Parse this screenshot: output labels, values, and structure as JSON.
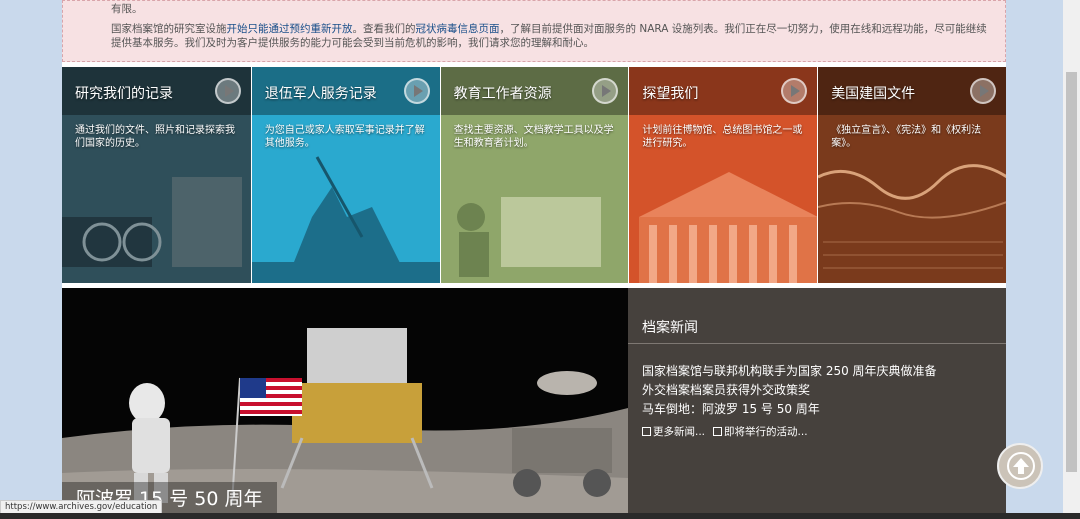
{
  "alert": {
    "line0": "有限。",
    "para_pre": "国家档案馆的研究室设施",
    "link1": "开始只能通过预约重新开放",
    "para_mid": "。查看我们的",
    "link2": "冠状病毒信息页面",
    "para_post": "，了解目前提供面对面服务的 NARA 设施列表。我们正在尽一切努力，使用在线和远程功能，尽可能继续提供基本服务。我们及时为客户提供服务的能力可能会受到当前危机的影响，我们请求您的理解和耐心。"
  },
  "tiles": [
    {
      "title": "研究我们的记录",
      "desc": "通过我们的文件、照片和记录探索我们国家的历史。",
      "color": "#2f4f5a"
    },
    {
      "title": "退伍军人服务记录",
      "desc": "为您自己或家人索取军事记录并了解其他服务。",
      "color": "#2aa9cf"
    },
    {
      "title": "教育工作者资源",
      "desc": "查找主要资源、文档教学工具以及学生和教育者计划。",
      "color": "#8fa66a"
    },
    {
      "title": "探望我们",
      "desc": "计划前往博物馆、总统图书馆之一或进行研究。",
      "color": "#d4532a"
    },
    {
      "title": "美国建国文件",
      "desc": "《独立宣言》、《宪法》和《权利法案》。",
      "color": "#7a3a1c"
    }
  ],
  "hero": {
    "caption": "阿波罗 15 号 50 周年"
  },
  "news": {
    "title": "档案新闻",
    "items": [
      "国家档案馆与联邦机构联手为国家 250 周年庆典做准备",
      "外交档案档案员获得外交政策奖",
      "马车倒地：阿波罗 15 号 50 周年"
    ],
    "more": "更多新闻...",
    "events": "即将举行的活动..."
  },
  "status": {
    "url": "https://www.archives.gov/education"
  }
}
